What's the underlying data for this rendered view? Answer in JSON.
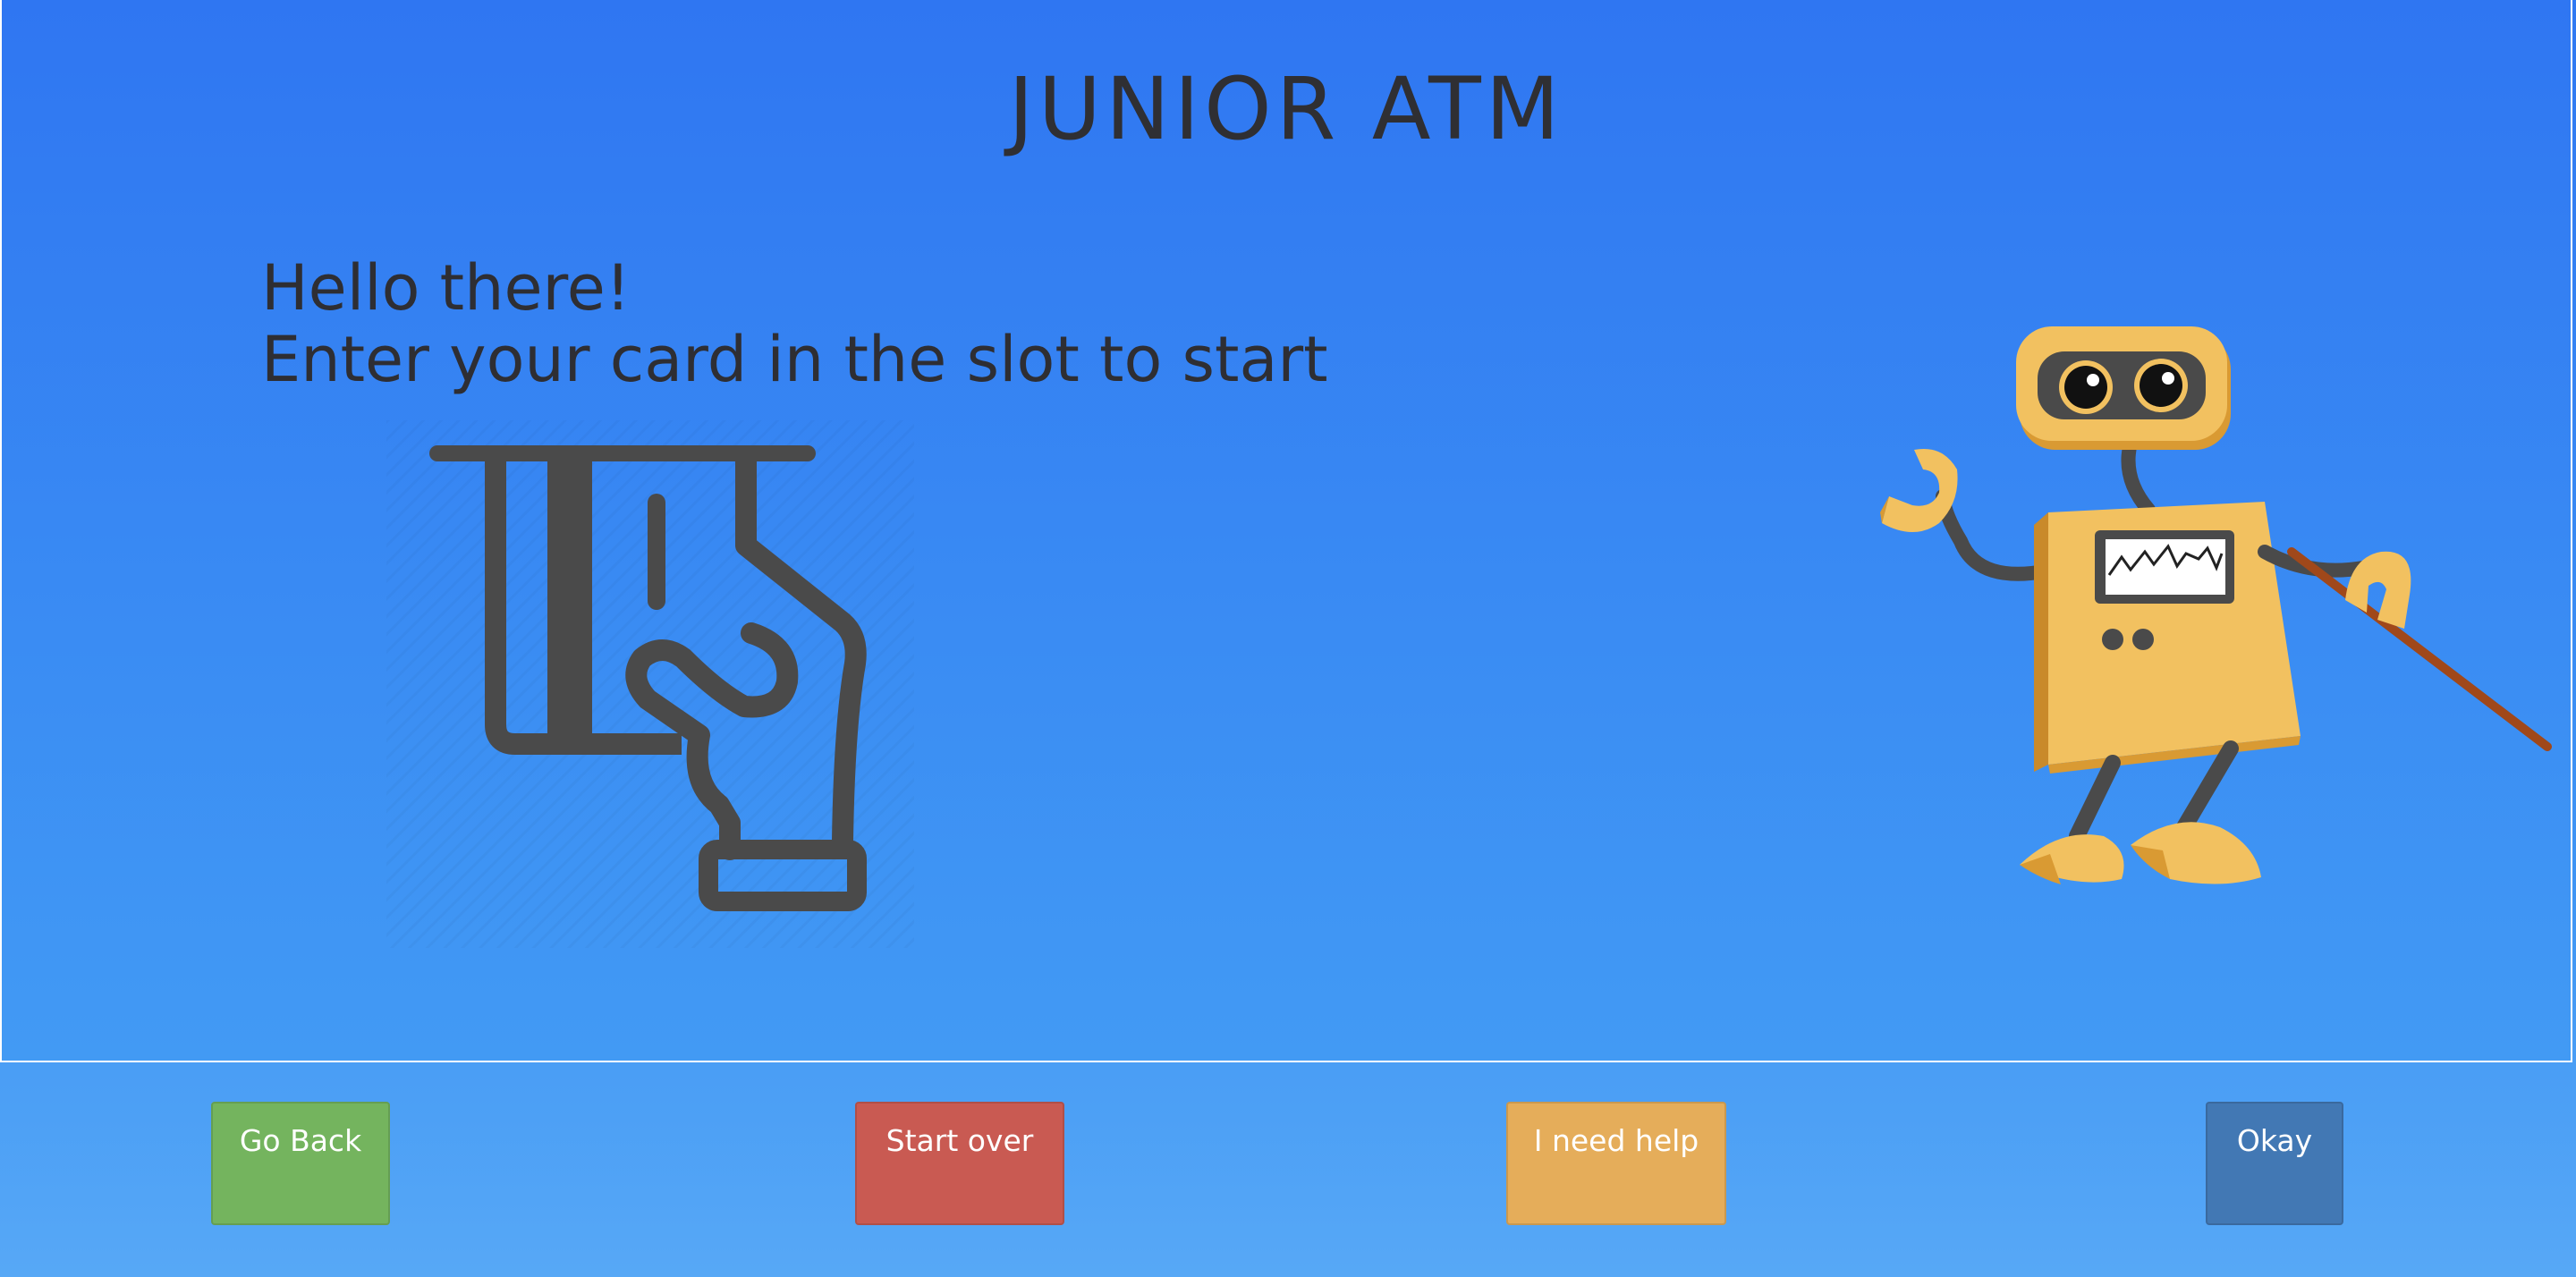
{
  "app": {
    "title": "JUNIOR ATM"
  },
  "main": {
    "greeting_line1": "Hello there!",
    "greeting_line2": "Enter your card in the slot to start",
    "illustration_icon": "card-insert-hand-icon",
    "mascot": "robot-mascot"
  },
  "footer": {
    "go_back_label": "Go Back",
    "start_over_label": "Start over",
    "help_label": "I need help",
    "okay_label": "Okay"
  },
  "colors": {
    "background": "#3a8cf3",
    "go_back": "#74b45e",
    "start_over": "#c95a52",
    "help": "#e5ad5a",
    "okay": "#4278b4",
    "text": "#2f2f33"
  }
}
